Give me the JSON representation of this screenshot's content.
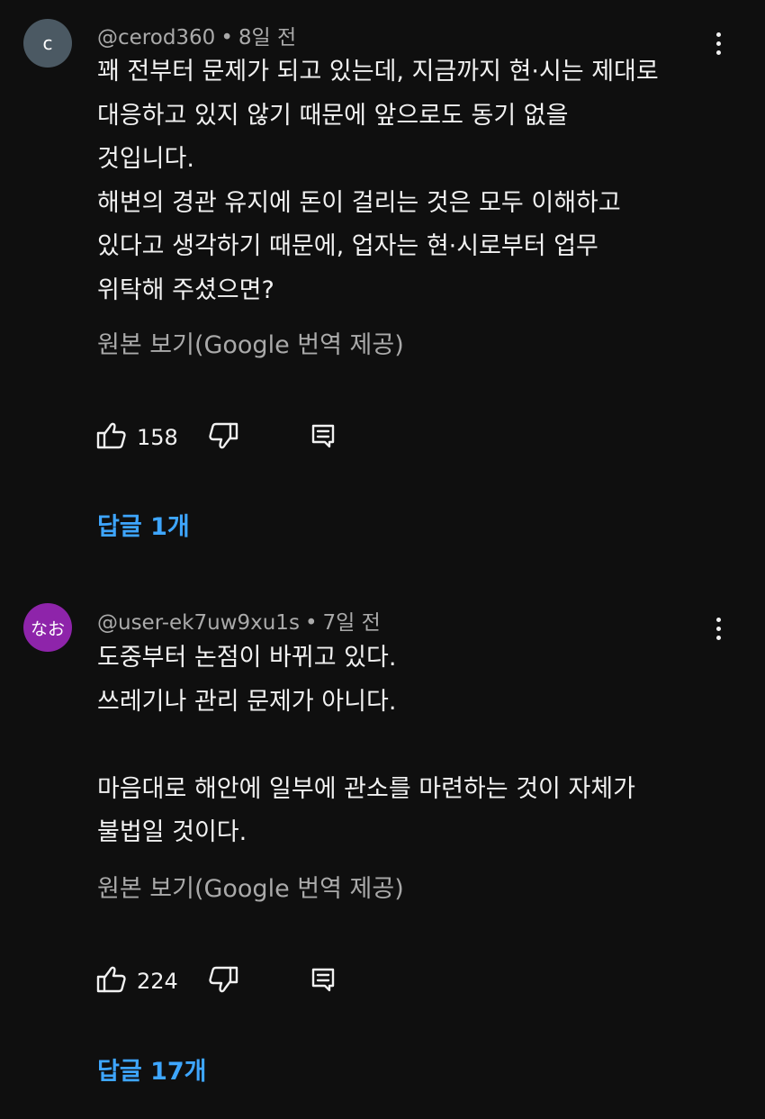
{
  "colors": {
    "background": "#0f0f0f",
    "text": "#f1f1f1",
    "secondary_text": "#aaaaaa",
    "link": "#3ea6ff",
    "avatar_1": "#4b5963",
    "avatar_2": "#8e24aa"
  },
  "comments": [
    {
      "avatar_text": "c",
      "author": "@cerod360",
      "separator": "•",
      "time": "8일 전",
      "text": "꽤 전부터 문제가 되고 있는데, 지금까지 현·시는 제대로\n대응하고 있지 않기 때문에 앞으로도 동기 없을\n것입니다.\n해변의 경관 유지에 돈이 걸리는 것은 모두 이해하고\n있다고 생각하기 때문에, 업자는 현·시로부터 업무\n위탁해 주셨으면?",
      "translate_link": "원본 보기(Google 번역 제공)",
      "like_count": "158",
      "replies_label": "답글 1개",
      "icons": {
        "like": "thumbs-up-icon",
        "dislike": "thumbs-down-icon",
        "reply": "reply-icon",
        "more": "more-vertical-icon"
      }
    },
    {
      "avatar_text": "なお",
      "author": "@user-ek7uw9xu1s",
      "separator": "•",
      "time": "7일 전",
      "text": "도중부터 논점이 바뀌고 있다.\n쓰레기나 관리 문제가 아니다.\n\n마음대로 해안에 일부에 관소를 마련하는 것이 자체가\n불법일 것이다.",
      "translate_link": "원본 보기(Google 번역 제공)",
      "like_count": "224",
      "replies_label": "답글 17개",
      "icons": {
        "like": "thumbs-up-icon",
        "dislike": "thumbs-down-icon",
        "reply": "reply-icon",
        "more": "more-vertical-icon"
      }
    }
  ]
}
